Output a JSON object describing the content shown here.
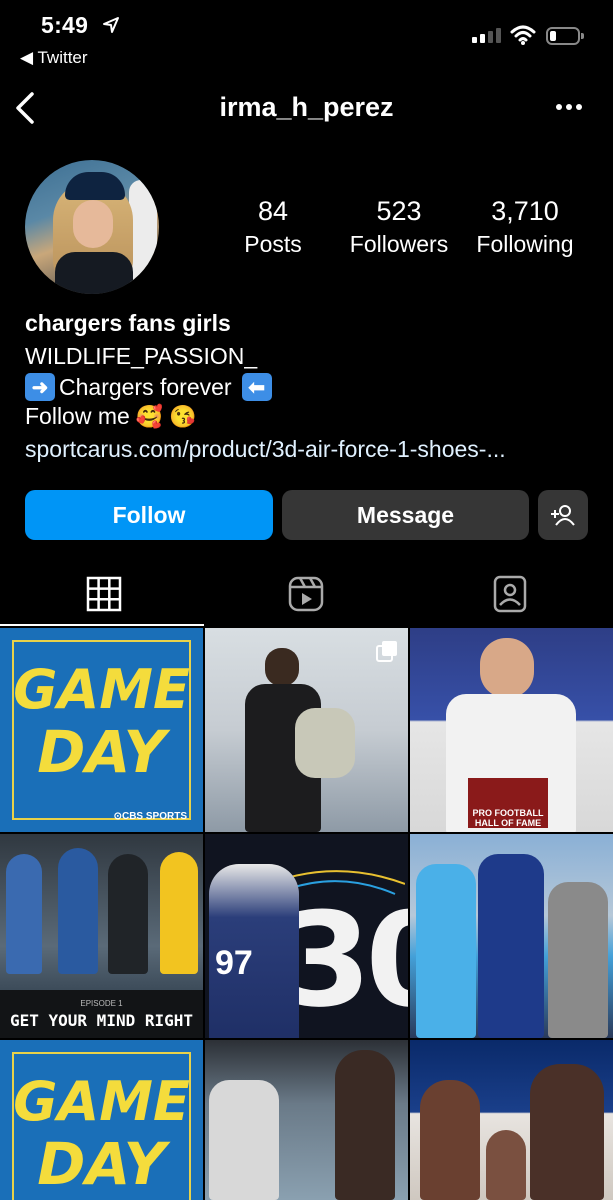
{
  "status_bar": {
    "time": "5:49",
    "back_app": "◀ Twitter"
  },
  "header": {
    "username": "irma_h_perez"
  },
  "stats": [
    {
      "value": "84",
      "label": "Posts"
    },
    {
      "value": "523",
      "label": "Followers"
    },
    {
      "value": "3,710",
      "label": "Following"
    }
  ],
  "bio": {
    "name": "chargers fans girls",
    "line1": "WILDLIFE_PASSION_",
    "line2_text": "Chargers forever",
    "line3_text": "Follow me",
    "line3_emojis": "🥰 😘",
    "link": "sportcarus.com/product/3d-air-force-1-shoes-..."
  },
  "actions": {
    "follow": "Follow",
    "message": "Message"
  },
  "grid": {
    "tile1_word1": "GAME",
    "tile1_word2": "DAY",
    "tile1_badge": "⊙CBS SPORTS",
    "tile3_text": "PRO FOOTBALL HALL OF FAME",
    "tile4_ep": "EPISODE 1",
    "tile4_title": "GET YOUR MIND RIGHT",
    "tile5_big": "30",
    "tile5_jersey": "97",
    "tile7_word1": "GAME",
    "tile7_word2": "DAY"
  },
  "colors": {
    "follow_blue": "#0095f6",
    "dark_button": "#363636",
    "background": "#000000"
  }
}
